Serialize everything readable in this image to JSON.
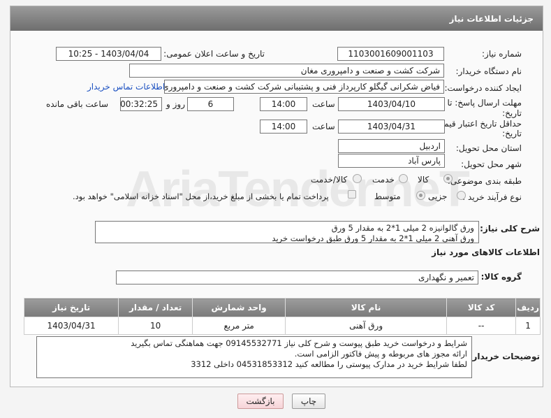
{
  "header": {
    "title": "جزئیات اطلاعات نیاز"
  },
  "fields": {
    "need_number_label": "شماره نیاز:",
    "need_number": "1103001609001103",
    "announce_label": "تاریخ و ساعت اعلان عمومی:",
    "announce_value": "1403/04/04 - 10:25",
    "buyer_org_label": "نام دستگاه خریدار:",
    "buyer_org": "شرکت کشت و صنعت و دامپروری مغان",
    "creator_label": "ایجاد کننده درخواست:",
    "creator": "فیاض شکرانی گیگلو کارپرداز فنی و پشتیبانی شرکت کشت و صنعت و دامپروری",
    "contact_link": "اطلاعات تماس خریدار",
    "deadline_label_1": "مهلت ارسال پاسخ: تا",
    "deadline_label_2": "تاریخ:",
    "deadline_date": "1403/04/10",
    "time_label": "ساعت",
    "deadline_time": "14:00",
    "days_value": "6",
    "days_label": "روز و",
    "remaining_value": "00:32:25",
    "remaining_label": "ساعت باقی مانده",
    "validity_label_1": "حداقل تاریخ اعتبار قیمت: تا",
    "validity_label_2": "تاریخ:",
    "validity_date": "1403/04/31",
    "validity_time_label": "ساعت",
    "validity_time": "14:00",
    "province_label": "استان محل تحویل:",
    "province": "اردبیل",
    "city_label": "شهر محل تحویل:",
    "city": "پارس آباد",
    "category_label": "طبقه بندی موضوعی:",
    "category_options": [
      "کالا",
      "خدمت",
      "کالا/خدمت"
    ],
    "process_label": "نوع فرآیند خرید :",
    "process_options": [
      "جزیی",
      "متوسط"
    ],
    "payment_note": "پرداخت تمام یا بخشی از مبلغ خرید،از محل \"اسناد خزانه اسلامی\" خواهد بود."
  },
  "summary": {
    "label": "شرح کلی نیاز:",
    "lines": [
      "ورق گالوانیزه 2 میلی  1*2  به مقدار 5 ورق",
      "ورق آهنی 2 میلی   1*2  به مقدار 5 ورق طبق درخواست خرید"
    ]
  },
  "goods": {
    "section_title": "اطلاعات کالاهای مورد نیاز",
    "group_label": "گروه کالا:",
    "group_value": "تعمیر و نگهداری",
    "columns": [
      "ردیف",
      "کد کالا",
      "نام کالا",
      "واحد شمارش",
      "تعداد / مقدار",
      "تاریخ نیاز"
    ],
    "rows": [
      [
        "1",
        "--",
        "ورق آهنی",
        "متر مربع",
        "10",
        "1403/04/31"
      ]
    ]
  },
  "notes": {
    "label": "توضیحات خریدار:",
    "lines": [
      "شرایط و درخواست خرید طبق پیوست و شرح کلی نیاز 09145532771 جهت هماهنگی تماس بگیرید",
      "ارائه مجوز های مربوطه و پیش فاکتور الزامی است.",
      "لطفا شرایط خرید در مدارک پیوستی را مطالعه کنید        04531853312   داخلی  3312"
    ]
  },
  "buttons": {
    "print": "چاپ",
    "back": "بازگشت"
  },
  "watermark": "AriaTender.neT"
}
